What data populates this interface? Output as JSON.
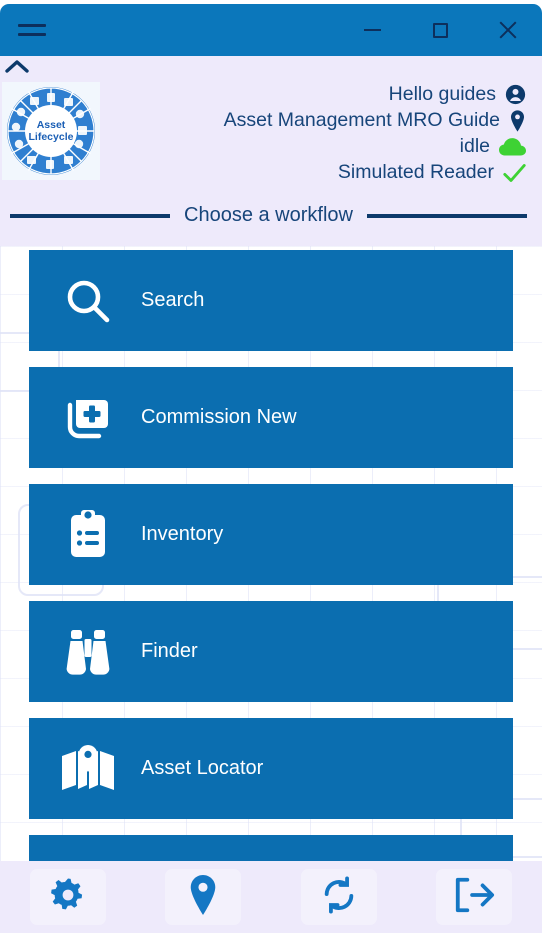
{
  "window": {
    "menu_icon": "hamburger-menu-icon",
    "controls": [
      {
        "name": "minimize",
        "glyph": "minimize-icon"
      },
      {
        "name": "maximize",
        "glyph": "maximize-icon"
      },
      {
        "name": "close",
        "glyph": "close-icon"
      }
    ]
  },
  "header": {
    "collapse_icon": "chevron-up-icon",
    "logo": {
      "name": "asset-lifecycle-logo",
      "center_line1": "Asset",
      "center_line2": "Lifecycle"
    },
    "info": [
      {
        "icon": "user-icon",
        "text": "Hello guides"
      },
      {
        "icon": "location-pin-icon",
        "text": "Asset Management MRO Guide"
      },
      {
        "icon": "cloud-icon",
        "text": "idle"
      },
      {
        "icon": "check-icon",
        "text": "Simulated Reader"
      }
    ],
    "section_title": "Choose a workflow"
  },
  "workflows": [
    {
      "icon": "search-icon",
      "label": "Search"
    },
    {
      "icon": "commission-new-icon",
      "label": "Commission New"
    },
    {
      "icon": "clipboard-list-icon",
      "label": "Inventory"
    },
    {
      "icon": "binoculars-icon",
      "label": "Finder"
    },
    {
      "icon": "map-pin-icon",
      "label": "Asset Locator"
    },
    {
      "icon": "partial-icon",
      "label": ""
    }
  ],
  "toolbar": [
    {
      "icon": "gear-icon",
      "label": "Settings"
    },
    {
      "icon": "location-pin-icon",
      "label": "Location"
    },
    {
      "icon": "refresh-icon",
      "label": "Sync"
    },
    {
      "icon": "logout-icon",
      "label": "Log out"
    }
  ],
  "colors": {
    "title_bar": "#0b77bb",
    "button_blue": "#0b6eb0",
    "header_bg": "#eeeafb",
    "text_navy": "#17457a",
    "accent_green": "#3ed234",
    "rule_navy": "#0d3a6b"
  }
}
